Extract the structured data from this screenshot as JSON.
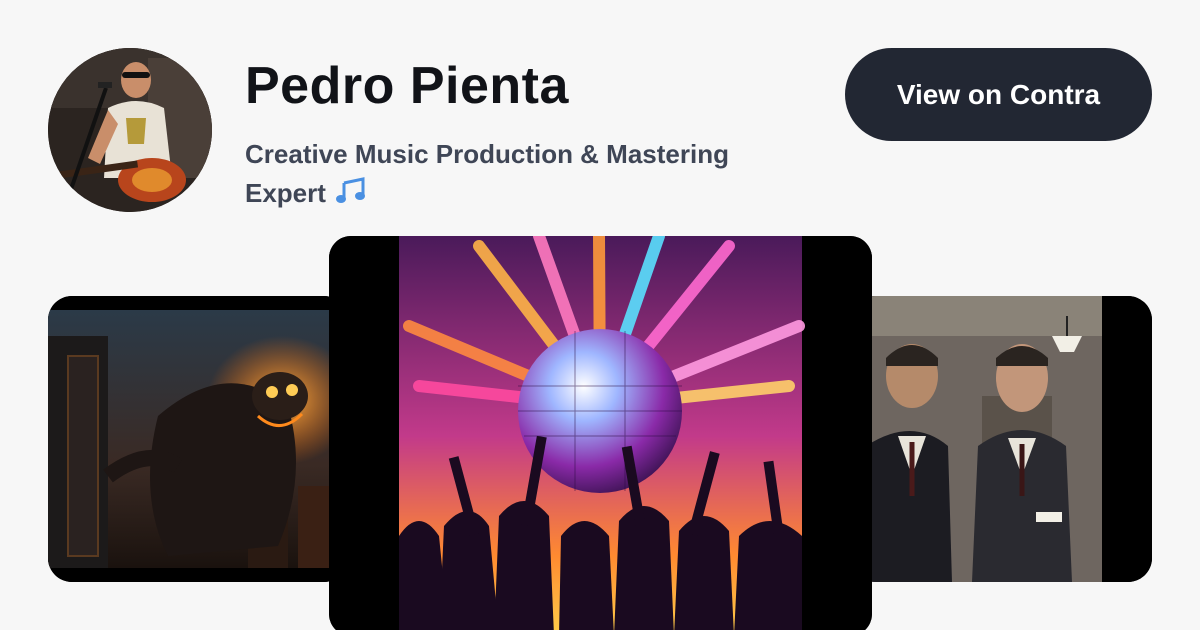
{
  "profile": {
    "name": "Pedro Pienta",
    "tagline": "Creative Music Production & Mastering Expert",
    "tagline_emoji_icon": "musical-notes-icon",
    "avatar_icon": "profile-photo-guitarist"
  },
  "cta": {
    "label": "View on Contra"
  },
  "gallery": [
    {
      "name": "project-image-monster-city"
    },
    {
      "name": "project-image-disco-ball-crowd"
    },
    {
      "name": "project-image-men-in-suits"
    }
  ],
  "colors": {
    "background": "#f7f7f7",
    "name_text": "#111318",
    "tagline_text": "#3f4656",
    "button_bg": "#222733",
    "button_text": "#ffffff",
    "note_icon": "#4a90e2"
  }
}
